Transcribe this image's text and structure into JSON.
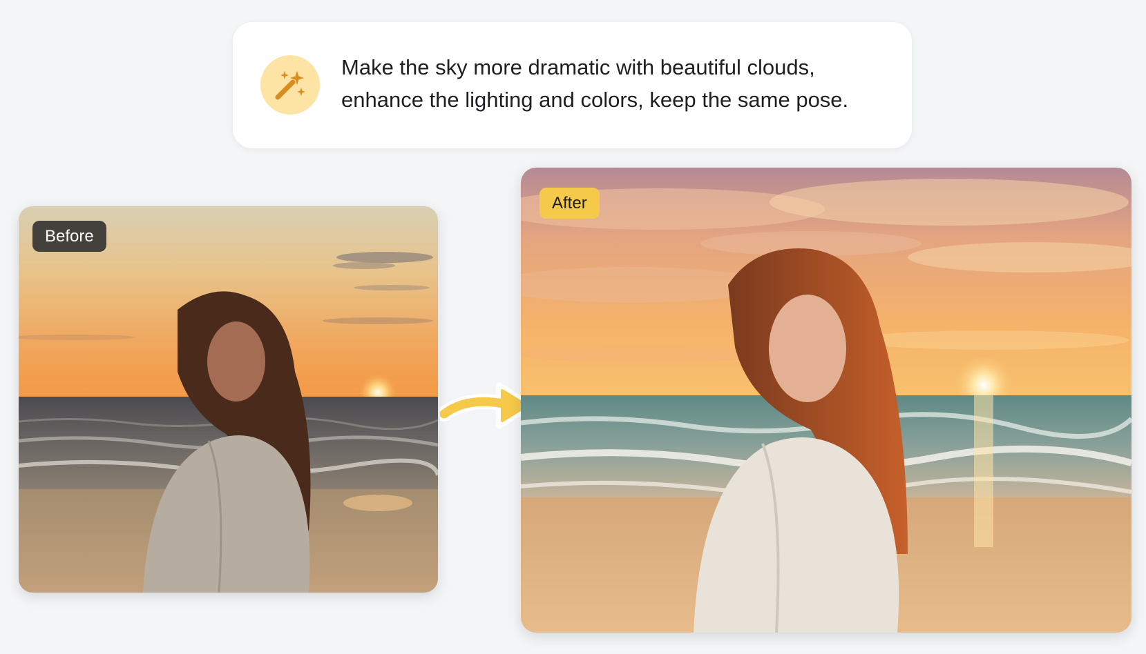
{
  "prompt": {
    "icon": "magic-wand-icon",
    "text": "Make the sky more dramatic with beautiful clouds, enhance the lighting and colors, keep the same pose."
  },
  "before": {
    "label": "Before"
  },
  "after": {
    "label": "After"
  },
  "arrow": {
    "icon": "curved-arrow-right-icon"
  },
  "colors": {
    "accent": "#f5c94a",
    "badge_bg": "#fde3a4",
    "wand": "#d98d1e",
    "before_label_bg": "#2d2d2d"
  }
}
